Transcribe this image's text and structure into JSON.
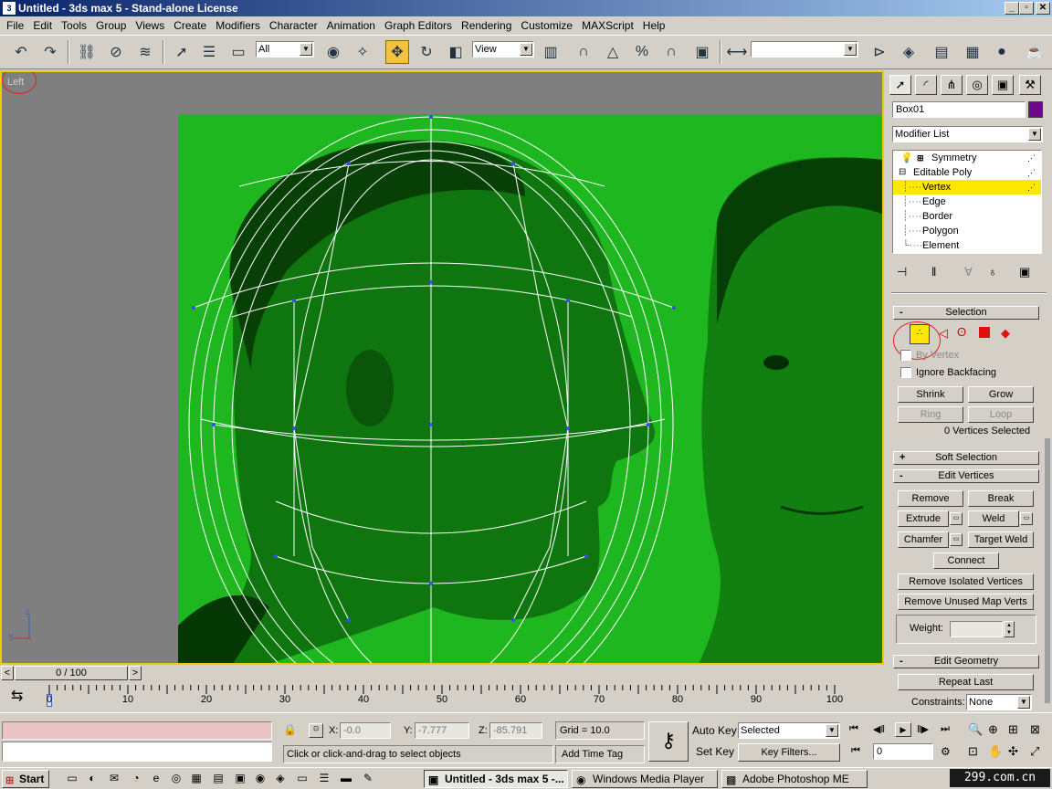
{
  "window": {
    "title": "Untitled - 3ds max 5 - Stand-alone License",
    "app_icon": "3ds-max-icon",
    "minimize": "_",
    "maximize": "▫",
    "close": "✕"
  },
  "menu": [
    "File",
    "Edit",
    "Tools",
    "Group",
    "Views",
    "Create",
    "Modifiers",
    "Character",
    "Animation",
    "Graph Editors",
    "Rendering",
    "Customize",
    "MAXScript",
    "Help"
  ],
  "toolbar": {
    "selection_filter": "All",
    "ref_coord": "View"
  },
  "viewport": {
    "label": "Left",
    "axis_z": "z",
    "axis_y": "y",
    "background_color": "#7f7f7f",
    "image_color": "#1fb71f",
    "active_border": "#e8d000"
  },
  "command_panel": {
    "object_name": "Box01",
    "object_color": "#6a0a8a",
    "modifier_list": "Modifier List",
    "stack": [
      {
        "label": "Symmetry",
        "level": 0,
        "selected": false
      },
      {
        "label": "Editable Poly",
        "level": 0,
        "selected": false
      },
      {
        "label": "Vertex",
        "level": 1,
        "selected": true
      },
      {
        "label": "Edge",
        "level": 1,
        "selected": false
      },
      {
        "label": "Border",
        "level": 1,
        "selected": false
      },
      {
        "label": "Polygon",
        "level": 1,
        "selected": false
      },
      {
        "label": "Element",
        "level": 1,
        "selected": false
      }
    ],
    "selection": {
      "title": "Selection",
      "by_vertex": "By Vertex",
      "ignore_backfacing": "Ignore Backfacing",
      "shrink": "Shrink",
      "grow": "Grow",
      "ring": "Ring",
      "loop": "Loop",
      "status": "0 Vertices Selected"
    },
    "soft_selection": "Soft Selection",
    "edit_vertices": {
      "title": "Edit Vertices",
      "remove": "Remove",
      "break": "Break",
      "extrude": "Extrude",
      "weld": "Weld",
      "chamfer": "Chamfer",
      "target_weld": "Target Weld",
      "connect": "Connect",
      "remove_isolated": "Remove Isolated Vertices",
      "remove_unused": "Remove Unused Map Verts",
      "weight_label": "Weight:",
      "weight_value": ""
    },
    "edit_geometry": {
      "title": "Edit Geometry",
      "repeat_last": "Repeat Last",
      "constraints_label": "Constraints:",
      "constraints_value": "None"
    }
  },
  "timeline": {
    "frame_display": "0 / 100",
    "prev": "<",
    "next": ">",
    "current": 0,
    "end": 100,
    "labels": [
      "0",
      "10",
      "20",
      "30",
      "40",
      "50",
      "60",
      "70",
      "80",
      "90",
      "100"
    ]
  },
  "status": {
    "x_label": "X:",
    "x_value": "-0.0",
    "y_label": "Y:",
    "y_value": "-7.777",
    "z_label": "Z:",
    "z_value": "-85.791",
    "grid": "Grid = 10.0",
    "prompt": "Click or click-and-drag to select objects",
    "add_time_tag": "Add Time Tag",
    "auto_key": "Auto Key",
    "set_key": "Set Key",
    "key_mode": "Selected",
    "key_filters": "Key Filters...",
    "current_frame": "0"
  },
  "taskbar": {
    "start": "Start",
    "tasks": [
      {
        "label": "Untitled - 3ds max 5 -...",
        "active": true
      },
      {
        "label": "Windows Media Player",
        "active": false
      },
      {
        "label": "Adobe Photoshop ME",
        "active": false
      }
    ],
    "watermark": "299.com.cn"
  }
}
